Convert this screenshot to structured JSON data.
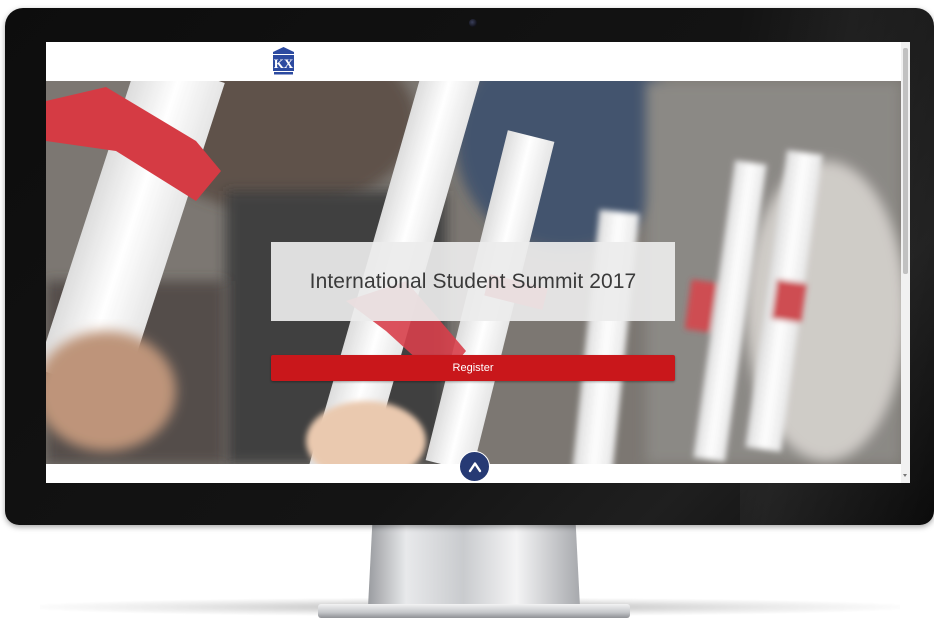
{
  "hero": {
    "title": "International Student Summit 2017",
    "register_label": "Register"
  },
  "icons": {
    "logo": "kx-shield-logo",
    "scroll_top": "chevron-up-icon"
  },
  "colors": {
    "register_button": "#c9171b",
    "scroll_top_button": "#263a74",
    "logo_blue": "#2c4aa0"
  }
}
